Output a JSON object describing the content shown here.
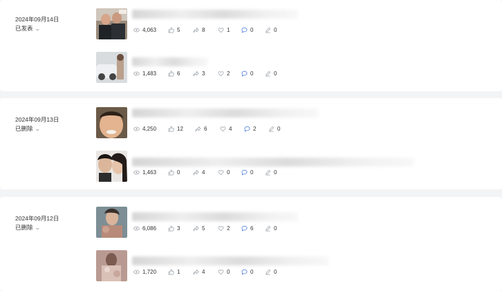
{
  "colors": {
    "background": "#f3f4f6",
    "card": "#ffffff",
    "icon": "#9aa0a6",
    "comment_icon": "#3b6fd8"
  },
  "icons": [
    "eye-icon",
    "thumbs-up-icon",
    "share-icon",
    "heart-icon",
    "comment-icon",
    "pencil-icon"
  ],
  "groups": [
    {
      "date": "2024年09月14日",
      "status": "已发表",
      "items": [
        {
          "views": "4,063",
          "likes": "5",
          "shares": "8",
          "favorites": "1",
          "comments": "0",
          "edits": "0"
        },
        {
          "views": "1,483",
          "likes": "6",
          "shares": "3",
          "favorites": "2",
          "comments": "0",
          "edits": "0"
        }
      ]
    },
    {
      "date": "2024年09月13日",
      "status": "已删除",
      "items": [
        {
          "views": "4,250",
          "likes": "12",
          "shares": "6",
          "favorites": "4",
          "comments": "2",
          "edits": "0"
        },
        {
          "views": "1,463",
          "likes": "0",
          "shares": "4",
          "favorites": "0",
          "comments": "0",
          "edits": "0"
        }
      ]
    },
    {
      "date": "2024年09月12日",
      "status": "已删除",
      "items": [
        {
          "views": "6,086",
          "likes": "3",
          "shares": "5",
          "favorites": "2",
          "comments": "6",
          "edits": "0"
        },
        {
          "views": "1,720",
          "likes": "1",
          "shares": "4",
          "favorites": "0",
          "comments": "0",
          "edits": "0"
        }
      ]
    }
  ]
}
